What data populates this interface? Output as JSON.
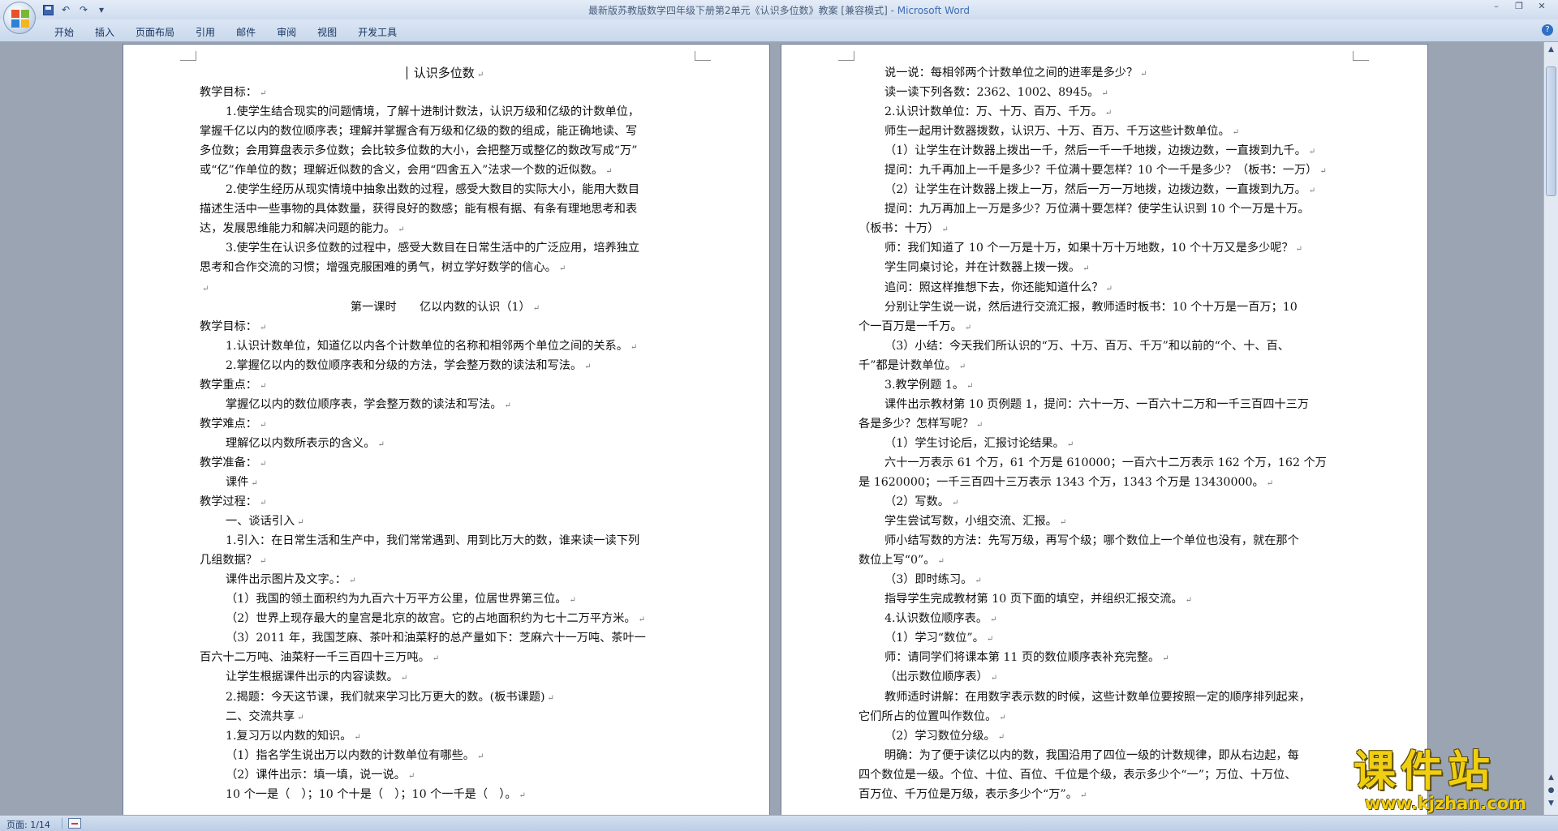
{
  "window": {
    "title": "最新版苏教版数学四年级下册第2单元《认识多位数》教案 [兼容模式] - ",
    "app_name": "Microsoft Word",
    "controls": [
      "–",
      "❐",
      "✕"
    ]
  },
  "quick_access": {
    "undo_label": "↶",
    "redo_label": "↷",
    "more_label": "▾"
  },
  "ribbon": {
    "tabs": [
      "开始",
      "插入",
      "页面布局",
      "引用",
      "邮件",
      "审阅",
      "视图",
      "开发工具"
    ],
    "help_label": "?"
  },
  "pages": {
    "left": [
      {
        "t": "认识多位数",
        "c": "ctr ttl",
        "cursor": true
      },
      {
        "t": "教学目标：",
        "c": ""
      },
      {
        "t": "1.使学生结合现实的问题情境，了解十进制计数法，认识万级和亿级的计数单位，",
        "c": "ind cont"
      },
      {
        "t": "掌握千亿以内的数位顺序表；理解并掌握含有万级和亿级的数的组成，能正确地读、写",
        "c": "cont"
      },
      {
        "t": "多位数；会用算盘表示多位数；会比较多位数的大小，会把整万或整亿的数改写成“万”",
        "c": "cont"
      },
      {
        "t": "或“亿”作单位的数；理解近似数的含义，会用“四舍五入”法求一个数的近似数。",
        "c": ""
      },
      {
        "t": "2.使学生经历从现实情境中抽象出数的过程，感受大数目的实际大小，能用大数目",
        "c": "ind cont"
      },
      {
        "t": "描述生活中一些事物的具体数量，获得良好的数感；能有根有据、有条有理地思考和表",
        "c": "cont"
      },
      {
        "t": "达，发展思维能力和解决问题的能力。",
        "c": ""
      },
      {
        "t": "3.使学生在认识多位数的过程中，感受大数目在日常生活中的广泛应用，培养独立",
        "c": "ind cont"
      },
      {
        "t": "思考和合作交流的习惯；增强克服困难的勇气，树立学好数学的信心。",
        "c": ""
      },
      {
        "t": "",
        "c": ""
      },
      {
        "t": "第一课时　　亿以内数的认识（1）",
        "c": "ctr"
      },
      {
        "t": "教学目标：",
        "c": ""
      },
      {
        "t": "1.认识计数单位，知道亿以内各个计数单位的名称和相邻两个单位之间的关系。",
        "c": "ind"
      },
      {
        "t": "2.掌握亿以内的数位顺序表和分级的方法，学会整万数的读法和写法。",
        "c": "ind"
      },
      {
        "t": "教学重点：",
        "c": ""
      },
      {
        "t": "掌握亿以内的数位顺序表，学会整万数的读法和写法。",
        "c": "ind"
      },
      {
        "t": "教学难点：",
        "c": ""
      },
      {
        "t": "理解亿以内数所表示的含义。",
        "c": "ind"
      },
      {
        "t": "教学准备：",
        "c": ""
      },
      {
        "t": "课件",
        "c": "ind"
      },
      {
        "t": "教学过程：",
        "c": ""
      },
      {
        "t": "一、谈话引入",
        "c": "ind"
      },
      {
        "t": "1.引入：在日常生活和生产中，我们常常遇到、用到比万大的数，谁来读一读下列",
        "c": "ind cont"
      },
      {
        "t": "几组数据？",
        "c": ""
      },
      {
        "t": "课件出示图片及文字。：",
        "c": "ind"
      },
      {
        "t": "（1）我国的领土面积约为九百六十万平方公里，位居世界第三位。",
        "c": "ind"
      },
      {
        "t": "（2）世界上现存最大的皇宫是北京的故宫。它的占地面积约为七十二万平方米。",
        "c": "ind"
      },
      {
        "t": "（3）2011 年，我国芝麻、茶叶和油菜籽的总产量如下：芝麻六十一万吨、茶叶一",
        "c": "ind cont"
      },
      {
        "t": "百六十二万吨、油菜籽一千三百四十三万吨。",
        "c": ""
      },
      {
        "t": "让学生根据课件出示的内容读数。",
        "c": "ind"
      },
      {
        "t": "2.揭题：今天这节课，我们就来学习比万更大的数。(板书课题)",
        "c": "ind"
      },
      {
        "t": "二、交流共享",
        "c": "ind"
      },
      {
        "t": "1.复习万以内数的知识。",
        "c": "ind"
      },
      {
        "t": "（1）指名学生说出万以内数的计数单位有哪些。",
        "c": "ind"
      },
      {
        "t": "（2）课件出示：填一填，说一说。",
        "c": "ind"
      },
      {
        "t": "10 个一是（　）；10 个十是（　）；10 个一千是（　）。",
        "c": "ind"
      }
    ],
    "right": [
      {
        "t": "说一说：每相邻两个计数单位之间的进率是多少？",
        "c": "ind"
      },
      {
        "t": "读一读下列各数：2362、1002、8945。",
        "c": "ind"
      },
      {
        "t": "2.认识计数单位：万、十万、百万、千万。",
        "c": "ind"
      },
      {
        "t": "师生一起用计数器拨数，认识万、十万、百万、千万这些计数单位。",
        "c": "ind"
      },
      {
        "t": "（1）让学生在计数器上拨出一千，然后一千一千地拨，边拨边数，一直拨到九千。",
        "c": "ind"
      },
      {
        "t": "提问：九千再加上一千是多少？千位满十要怎样？10 个一千是多少？（板书：一万）",
        "c": "ind"
      },
      {
        "t": "（2）让学生在计数器上拨上一万，然后一万一万地拨，边拨边数，一直拨到九万。",
        "c": "ind"
      },
      {
        "t": "提问：九万再加上一万是多少？万位满十要怎样？使学生认识到 10 个一万是十万。",
        "c": "ind cont"
      },
      {
        "t": "（板书：十万）",
        "c": ""
      },
      {
        "t": "师：我们知道了 10 个一万是十万，如果十万十万地数，10 个十万又是多少呢？",
        "c": "ind"
      },
      {
        "t": "学生同桌讨论，并在计数器上拨一拨。",
        "c": "ind"
      },
      {
        "t": "追问：照这样推想下去，你还能知道什么？",
        "c": "ind"
      },
      {
        "t": "分别让学生说一说，然后进行交流汇报，教师适时板书：10 个十万是一百万；10",
        "c": "ind cont"
      },
      {
        "t": "个一百万是一千万。",
        "c": ""
      },
      {
        "t": "（3）小结：今天我们所认识的“万、十万、百万、千万”和以前的“个、十、百、",
        "c": "ind cont"
      },
      {
        "t": "千”都是计数单位。",
        "c": ""
      },
      {
        "t": "3.教学例题 1。",
        "c": "ind"
      },
      {
        "t": "课件出示教材第 10 页例题 1，提问：六十一万、一百六十二万和一千三百四十三万",
        "c": "ind cont"
      },
      {
        "t": "各是多少？怎样写呢？",
        "c": ""
      },
      {
        "t": "（1）学生讨论后，汇报讨论结果。",
        "c": "ind"
      },
      {
        "t": "六十一万表示 61 个万，61 个万是 610000；一百六十二万表示 162 个万，162 个万",
        "c": "ind cont"
      },
      {
        "t": "是 1620000；一千三百四十三万表示 1343 个万，1343 个万是 13430000。",
        "c": ""
      },
      {
        "t": "（2）写数。",
        "c": "ind"
      },
      {
        "t": "学生尝试写数，小组交流、汇报。",
        "c": "ind"
      },
      {
        "t": "师小结写数的方法：先写万级，再写个级；哪个数位上一个单位也没有，就在那个",
        "c": "ind cont"
      },
      {
        "t": "数位上写“0”。",
        "c": ""
      },
      {
        "t": "（3）即时练习。",
        "c": "ind"
      },
      {
        "t": "指导学生完成教材第 10 页下面的填空，并组织汇报交流。",
        "c": "ind"
      },
      {
        "t": "4.认识数位顺序表。",
        "c": "ind"
      },
      {
        "t": "（1）学习“数位”。",
        "c": "ind"
      },
      {
        "t": "师：请同学们将课本第 11 页的数位顺序表补充完整。",
        "c": "ind"
      },
      {
        "t": "（出示数位顺序表）",
        "c": "ind"
      },
      {
        "t": "教师适时讲解：在用数字表示数的时候，这些计数单位要按照一定的顺序排列起来，",
        "c": "ind cont"
      },
      {
        "t": "它们所占的位置叫作数位。",
        "c": ""
      },
      {
        "t": "（2）学习数位分级。",
        "c": "ind"
      },
      {
        "t": "明确：为了便于读亿以内的数，我国沿用了四位一级的计数规律，即从右边起，每",
        "c": "ind cont"
      },
      {
        "t": "四个数位是一级。个位、十位、百位、千位是个级，表示多少个“一”；万位、十万位、",
        "c": "cont"
      },
      {
        "t": "百万位、千万位是万级，表示多少个“万”。",
        "c": ""
      }
    ]
  },
  "status": {
    "page_info": "页面: 1/14"
  },
  "watermark": {
    "name": "课件站",
    "url": "www.kjzhan.com"
  }
}
